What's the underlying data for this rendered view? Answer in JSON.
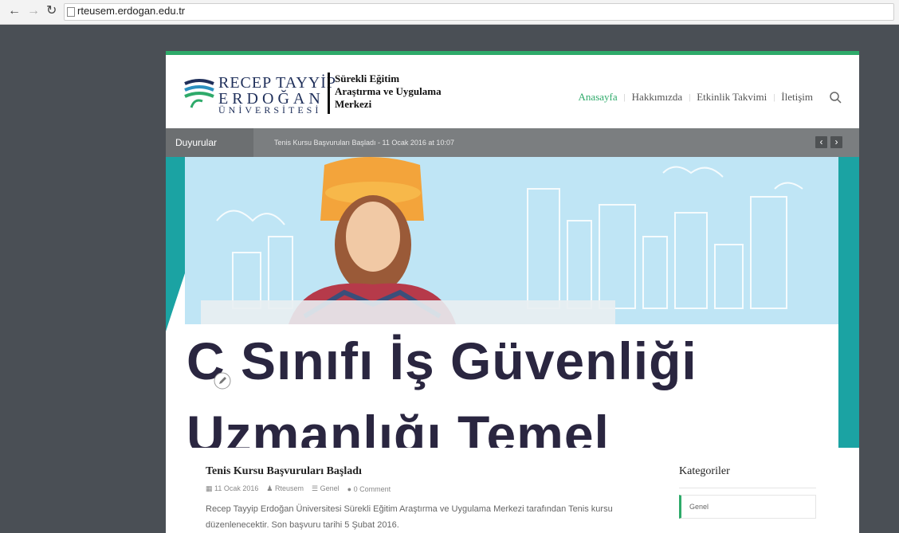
{
  "browser": {
    "back_icon": "back-arrow-icon",
    "forward_icon": "forward-arrow-icon",
    "reload_icon": "reload-icon",
    "url": "rteusem.erdogan.edu.tr"
  },
  "logo": {
    "line1": "RECEP TAYYİP",
    "line2": "ERDOĞAN",
    "line3": "ÜNİVERSİTESİ",
    "subtitle": [
      "Sürekli Eğitim",
      "Araştırma ve Uygulama",
      "Merkezi"
    ]
  },
  "menu": {
    "items": [
      {
        "label": "Anasayfa",
        "active": true
      },
      {
        "label": "Hakkımızda",
        "active": false
      },
      {
        "label": "Etkinlik Takvimi",
        "active": false
      },
      {
        "label": "İletişim",
        "active": false
      }
    ],
    "search_icon": "search-icon"
  },
  "ticker": {
    "label": "Duyurular",
    "text": "Tenis Kursu Başvuruları Başladı - 11 Ocak 2016 at 10:07",
    "prev": "‹",
    "next": "›"
  },
  "hero": {
    "title_line1": "C Sınıfı İş Güvenliği",
    "title_line2": "Uzmanlığı Temel"
  },
  "post": {
    "title": "Tenis Kursu Başvuruları Başladı",
    "date": "11 Ocak 2016",
    "author": "Rteusem",
    "category": "Genel",
    "comments": "0 Comment",
    "excerpt": "Recep Tayyip Erdoğan Üniversitesi Sürekli Eğitim Araştırma ve Uygulama Merkezi tarafından Tenis kursu düzenlenecektir. Son başvuru tarihi 5 Şubat 2016."
  },
  "sidebar": {
    "title": "Kategoriler",
    "categories": [
      "Genel"
    ]
  },
  "colors": {
    "accent_green": "#2eaa6a",
    "teal": "#1ba3a3",
    "backdrop": "#4a4f55",
    "ticker_bg": "#7b7e80"
  }
}
